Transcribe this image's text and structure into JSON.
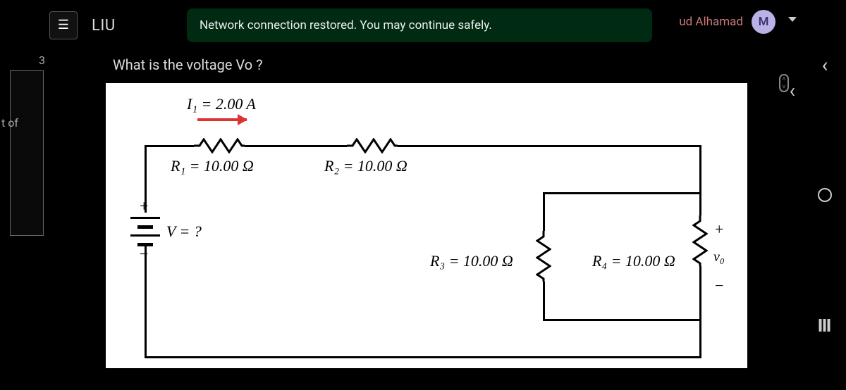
{
  "header": {
    "brand": "LIU",
    "toast": "Network connection restored. You may continue safely.",
    "user_suffix": "ud Alhamad",
    "avatar_initial": "M"
  },
  "sidebar": {
    "frag1": "3",
    "frag2": "t of"
  },
  "question": {
    "prompt": "What is the voltage Vo ?"
  },
  "circuit": {
    "I1": "I₁ = 2.00 A",
    "R1": "R₁ = 10.00 Ω",
    "R2": "R₂ = 10.00 Ω",
    "R3": "R₃ = 10.00 Ω",
    "R4": "R₄ = 10.00 Ω",
    "V": "V = ?",
    "vo_label": "v₀",
    "plus": "+",
    "minus": "−"
  },
  "rail": {
    "back": "‹"
  }
}
